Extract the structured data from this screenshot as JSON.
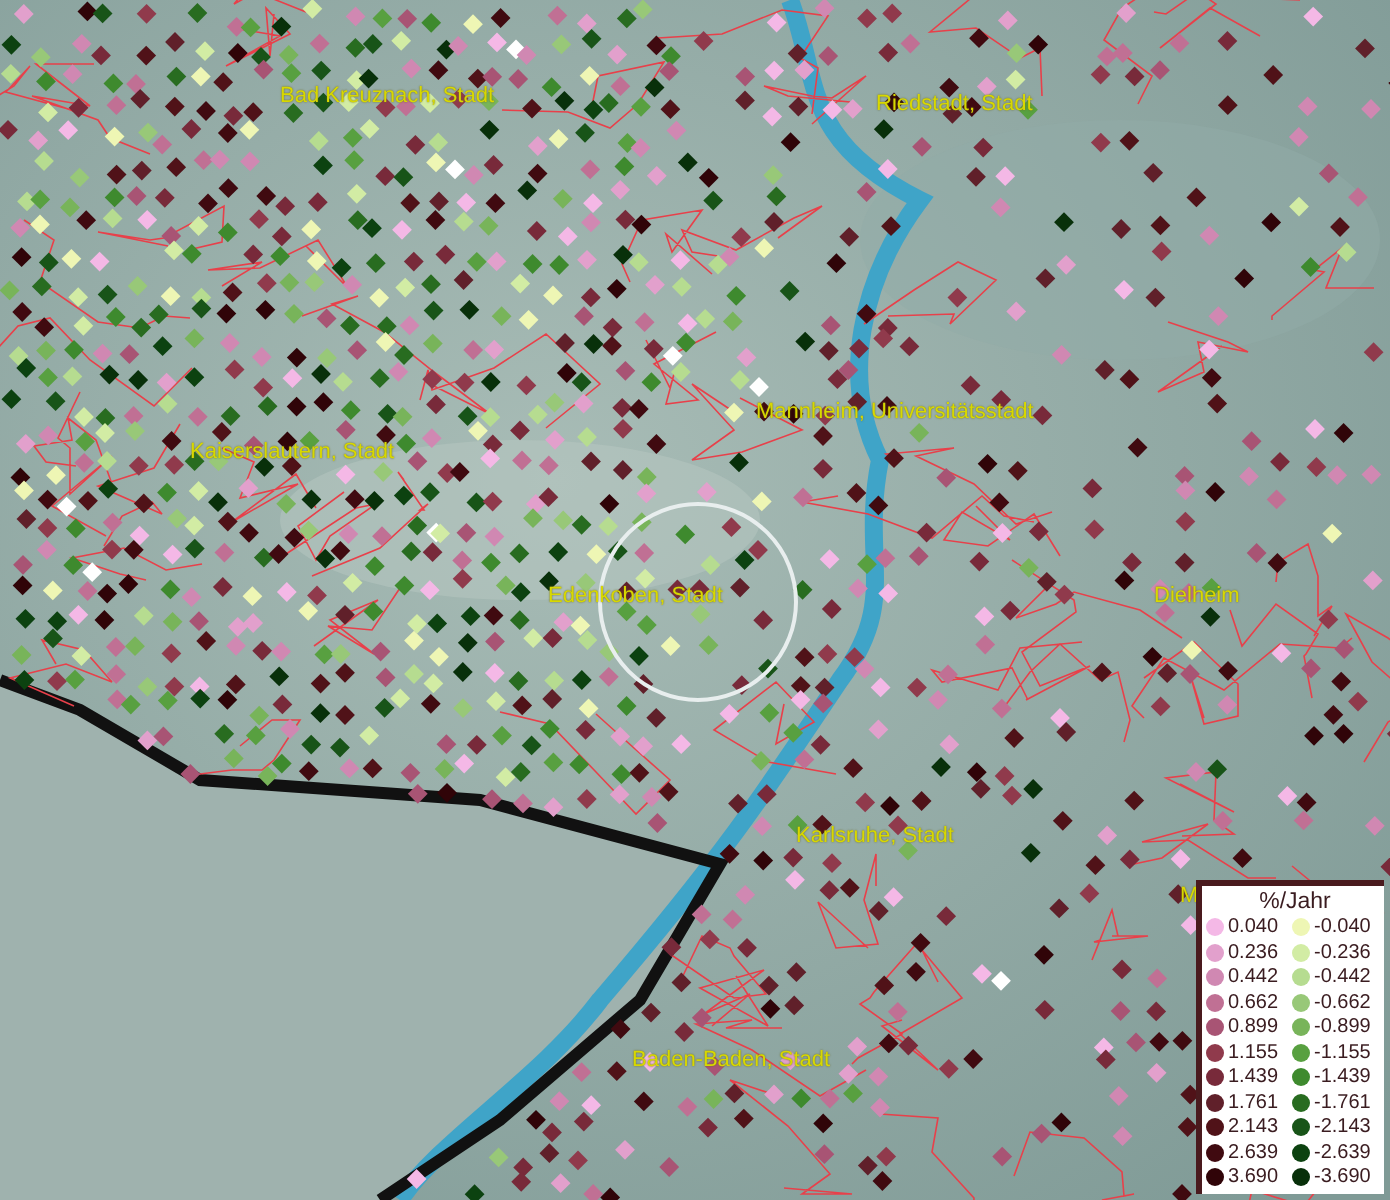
{
  "map": {
    "places": [
      {
        "name": "Bad Kreuznach, Stadt"
      },
      {
        "name": "Riedstadt, Stadt"
      },
      {
        "name": "Kaiserslautern, Stadt"
      },
      {
        "name": "Mannheim, Universitätsstadt"
      },
      {
        "name": "Edenkoben, Stadt"
      },
      {
        "name": "Dielheim"
      },
      {
        "name": "Karlsruhe, Stadt"
      },
      {
        "name": "Baden-Baden, Stadt"
      },
      {
        "name": "M"
      }
    ]
  },
  "legend": {
    "title": "%/Jahr",
    "rows": [
      {
        "increase": {
          "value": "0.040",
          "color": "#f4b8e6"
        },
        "decrease": {
          "value": "-0.040",
          "color": "#eef6b4"
        }
      },
      {
        "increase": {
          "value": "0.236",
          "color": "#e2a0cc"
        },
        "decrease": {
          "value": "-0.236",
          "color": "#d2eca4"
        }
      },
      {
        "increase": {
          "value": "0.442",
          "color": "#d088b2"
        },
        "decrease": {
          "value": "-0.442",
          "color": "#b6dc90"
        }
      },
      {
        "increase": {
          "value": "0.662",
          "color": "#c07094"
        },
        "decrease": {
          "value": "-0.662",
          "color": "#98c878"
        }
      },
      {
        "increase": {
          "value": "0.899",
          "color": "#a85474"
        },
        "decrease": {
          "value": "-0.899",
          "color": "#78b45a"
        }
      },
      {
        "increase": {
          "value": "1.155",
          "color": "#903a4c"
        },
        "decrease": {
          "value": "-1.155",
          "color": "#58a040"
        }
      },
      {
        "increase": {
          "value": "1.439",
          "color": "#782a3a"
        },
        "decrease": {
          "value": "-1.439",
          "color": "#3e8a2e"
        }
      },
      {
        "increase": {
          "value": "1.761",
          "color": "#60202a"
        },
        "decrease": {
          "value": "-1.761",
          "color": "#286c20"
        }
      },
      {
        "increase": {
          "value": "2.143",
          "color": "#501218"
        },
        "decrease": {
          "value": "-2.143",
          "color": "#185418"
        }
      },
      {
        "increase": {
          "value": "2.639",
          "color": "#400a10"
        },
        "decrease": {
          "value": "-2.639",
          "color": "#0c4210"
        }
      },
      {
        "increase": {
          "value": "3.690",
          "color": "#300408"
        },
        "decrease": {
          "value": "-3.690",
          "color": "#08300a"
        }
      }
    ]
  }
}
